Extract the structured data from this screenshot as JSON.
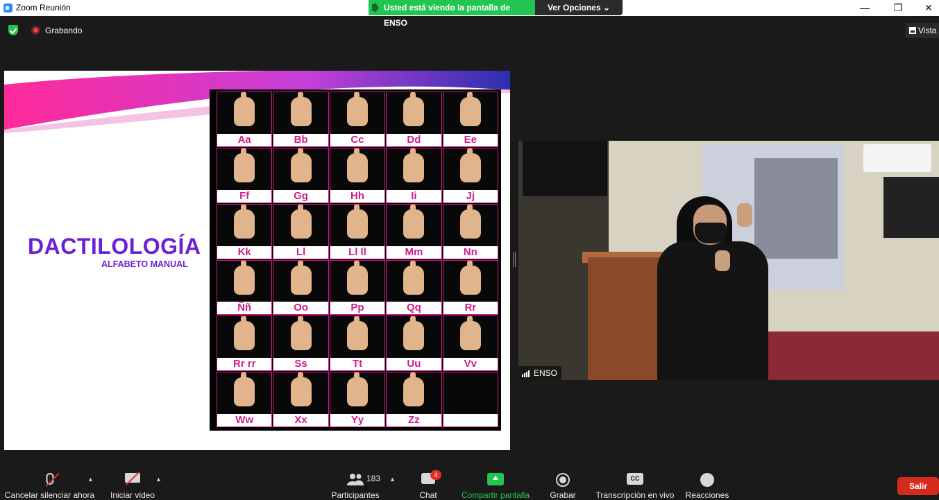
{
  "window": {
    "title": "Zoom Reunión",
    "controls": [
      "—",
      "❐",
      "✕"
    ]
  },
  "share_banner": {
    "text": "Usted está viendo la pantalla de ENSO",
    "view_options": "Ver Opciones"
  },
  "status": {
    "recording_label": "Grabando",
    "view_label": "Vista"
  },
  "slide": {
    "title": "DACTILOLOGÍA",
    "subtitle": "ALFABETO MANUAL",
    "letters": [
      "Aa",
      "Bb",
      "Cc",
      "Dd",
      "Ee",
      "Ff",
      "Gg",
      "Hh",
      "Ii",
      "Jj",
      "Kk",
      "Ll",
      "Ll ll",
      "Mm",
      "Nn",
      "Ññ",
      "Oo",
      "Pp",
      "Qq",
      "Rr",
      "Rr rr",
      "Ss",
      "Tt",
      "Uu",
      "Vv",
      "Ww",
      "Xx",
      "Yy",
      "Zz",
      ""
    ],
    "accent_color": "#d01c8b",
    "title_color": "#6b1fd6"
  },
  "video": {
    "participant_name": "ENSO"
  },
  "toolbar": {
    "mute_label": "Cancelar silenciar ahora",
    "video_label": "Iniciar video",
    "participants_label": "Participantes",
    "participants_count": "183",
    "chat_label": "Chat",
    "chat_badge": "4",
    "share_label": "Compartir pantalla",
    "record_label": "Grabar",
    "cc_label": "Transcripción en vivo",
    "cc_icon_text": "CC",
    "reactions_label": "Reacciones",
    "leave_label": "Salir"
  },
  "colors": {
    "share_green": "#23c552",
    "leave_red": "#d52b1e",
    "toolbar_bg": "#1a1a1a"
  }
}
